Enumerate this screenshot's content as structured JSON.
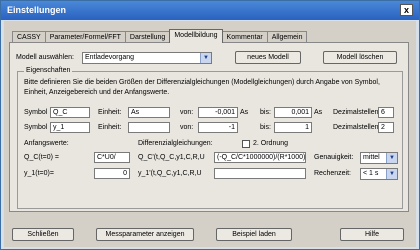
{
  "window": {
    "title": "Einstellungen",
    "close_glyph": "x"
  },
  "tabs": [
    {
      "label": "CASSY"
    },
    {
      "label": "Parameter/Formel/FFT"
    },
    {
      "label": "Darstellung"
    },
    {
      "label": "Modellbildung"
    },
    {
      "label": "Kommentar"
    },
    {
      "label": "Allgemein"
    }
  ],
  "model": {
    "select_label": "Modell auswählen:",
    "selected": "Entladevorgang",
    "new_button": "neues Modell",
    "delete_button": "Modell löschen"
  },
  "properties": {
    "title": "Eigenschaften",
    "description": "Bitte definieren Sie die beiden Größen der Differenzialgleichungen (Modellgleichungen) durch Angabe von Symbol, Einheit, Anzeigebereich und der Anfangswerte.",
    "rows": [
      {
        "symbol_label": "Symbol",
        "symbol": "Q_C",
        "unit_label": "Einheit:",
        "unit": "As",
        "from_label": "von:",
        "from": "-0,001",
        "from_unit": "As",
        "to_label": "bis:",
        "to": "0,001",
        "to_unit": "As",
        "decimals_label": "Dezimalstellen:",
        "decimals": "6"
      },
      {
        "symbol_label": "Symbol",
        "symbol": "y_1",
        "unit_label": "Einheit:",
        "unit": "",
        "from_label": "von:",
        "from": "-1",
        "from_unit": "",
        "to_label": "bis:",
        "to": "1",
        "to_unit": "",
        "decimals_label": "Dezimalstellen:",
        "decimals": "2"
      }
    ],
    "initial_label": "Anfangswerte:",
    "initial": [
      {
        "label": "Q_C(t=0) =",
        "value": "C*U0/"
      },
      {
        "label": "y_1(t=0)=",
        "value": "0"
      }
    ],
    "diff_label": "Differenzialgleichungen:",
    "second_order_label": "2. Ordnung",
    "equations": [
      {
        "label": "Q_C'(t,Q_C,y1,C,R,U",
        "value": "(-Q_C/C*1000000)/(R*1000)"
      },
      {
        "label": "y_1'(t,Q_C,y1,C,R,U",
        "value": ""
      }
    ],
    "accuracy_label": "Genauigkeit:",
    "accuracy": "mittel",
    "calc_time_label": "Rechenzeit:",
    "calc_time": "< 1 s"
  },
  "footer": {
    "close": "Schließen",
    "measure_params": "Messparameter anzeigen",
    "load_example": "Beispiel laden",
    "help": "Hilfe"
  }
}
